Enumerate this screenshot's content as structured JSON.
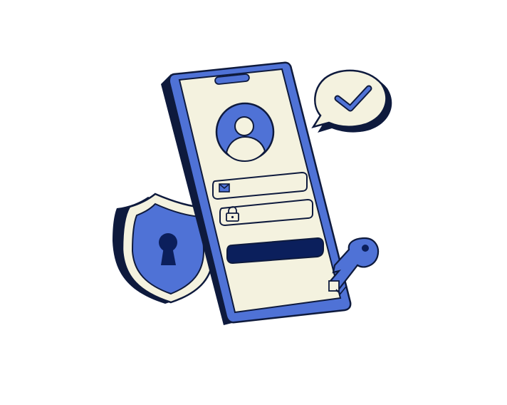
{
  "illustration": {
    "subject": "mobile-secure-login",
    "icons": {
      "avatar": "user-avatar-icon",
      "email": "envelope-icon",
      "password": "padlock-icon",
      "shield": "shield-keyhole-icon",
      "chat": "checkmark-speech-bubble-icon",
      "key": "key-icon"
    },
    "colors": {
      "blue": "#4f72d6",
      "navy": "#0b1f5c",
      "outline": "#0e1a3d",
      "cream": "#f4f2df",
      "background": "#ffffff"
    }
  }
}
